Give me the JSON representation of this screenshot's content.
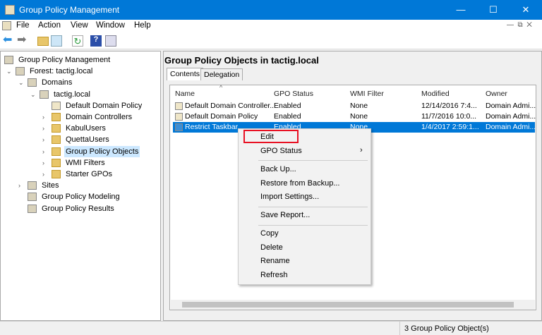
{
  "window": {
    "title": "Group Policy Management",
    "minimize": "—",
    "maximize": "☐",
    "close": "✕"
  },
  "menu": [
    "File",
    "Action",
    "View",
    "Window",
    "Help"
  ],
  "tree": [
    {
      "label": "Group Policy Management",
      "level": 0,
      "exp": ""
    },
    {
      "label": "Forest: tactig.local",
      "level": 1,
      "exp": "⌄"
    },
    {
      "label": "Domains",
      "level": 2,
      "exp": "⌄"
    },
    {
      "label": "tactig.local",
      "level": 3,
      "exp": "⌄"
    },
    {
      "label": "Default Domain Policy",
      "level": 4,
      "exp": ""
    },
    {
      "label": "Domain Controllers",
      "level": 4,
      "exp": "›"
    },
    {
      "label": "KabulUsers",
      "level": 4,
      "exp": "›"
    },
    {
      "label": "QuettaUsers",
      "level": 4,
      "exp": "›"
    },
    {
      "label": "Group Policy Objects",
      "level": 4,
      "exp": "›",
      "selected": true
    },
    {
      "label": "WMI Filters",
      "level": 4,
      "exp": "›"
    },
    {
      "label": "Starter GPOs",
      "level": 4,
      "exp": "›"
    },
    {
      "label": "Sites",
      "level": 2,
      "exp": "›"
    },
    {
      "label": "Group Policy Modeling",
      "level": 2,
      "exp": ""
    },
    {
      "label": "Group Policy Results",
      "level": 2,
      "exp": ""
    }
  ],
  "main": {
    "header": "Group Policy Objects in tactig.local",
    "tabs": [
      "Contents",
      "Delegation"
    ],
    "columns": [
      "Name",
      "GPO Status",
      "WMI Filter",
      "Modified",
      "Owner"
    ],
    "rows": [
      [
        "Default Domain Controller...",
        "Enabled",
        "None",
        "12/14/2016 7:4...",
        "Domain Admi..."
      ],
      [
        "Default Domain Policy",
        "Enabled",
        "None",
        "11/7/2016 10:0...",
        "Domain Admi..."
      ],
      [
        "Restrict Taskbar",
        "Enabled",
        "None",
        "1/4/2017 2:59:1...",
        "Domain Admi..."
      ]
    ]
  },
  "context_menu": {
    "items": [
      "Edit",
      "GPO Status",
      "Back Up...",
      "Restore from Backup...",
      "Import Settings...",
      "Save Report...",
      "Copy",
      "Delete",
      "Rename",
      "Refresh"
    ],
    "highlight_color": "#e81123"
  },
  "status": "3 Group Policy Object(s)"
}
